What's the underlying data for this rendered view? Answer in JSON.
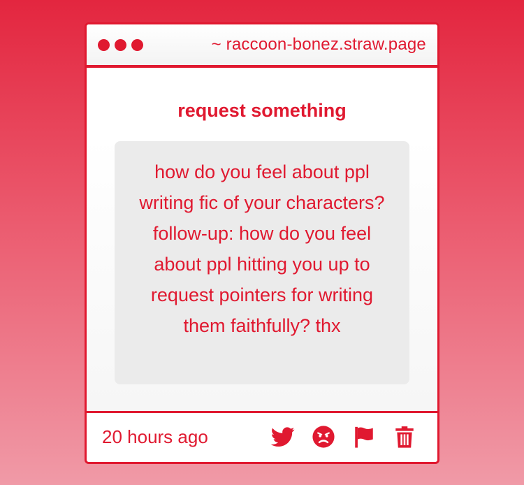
{
  "window": {
    "url": "~ raccoon-bonez.straw.page"
  },
  "main": {
    "heading": "request something",
    "question": "how do you feel about ppl writing fic of your characters? follow-up: how do you feel about ppl hitting you up to request pointers for writing them faithfully? thx"
  },
  "footer": {
    "timestamp": "20 hours ago",
    "actions": [
      "twitter-icon",
      "angry-face-icon",
      "flag-icon",
      "trash-icon"
    ]
  },
  "colors": {
    "accent": "#e01930",
    "background_top": "#e3263f",
    "background_bottom": "#f09aa7",
    "question_box": "#ebebeb"
  }
}
